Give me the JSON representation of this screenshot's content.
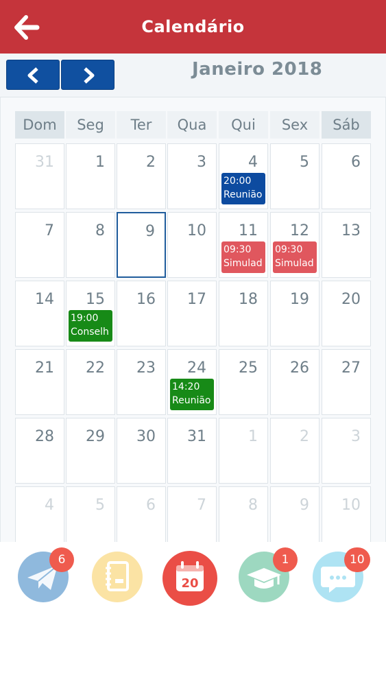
{
  "header": {
    "title": "Calendário",
    "back_icon": "arrow-left-icon"
  },
  "navigation": {
    "month_label": "Janeiro 2018",
    "prev_icon": "chevron-left-icon",
    "next_icon": "chevron-right-icon"
  },
  "weekdays": [
    "Dom",
    "Seg",
    "Ter",
    "Qua",
    "Qui",
    "Sex",
    "Sáb"
  ],
  "weeks": [
    [
      {
        "day": "31",
        "current": false
      },
      {
        "day": "1",
        "current": true
      },
      {
        "day": "2",
        "current": true
      },
      {
        "day": "3",
        "current": true
      },
      {
        "day": "4",
        "current": true,
        "events": [
          {
            "time": "20:00",
            "title": "Reunião",
            "color": "#0d4ba0"
          }
        ]
      },
      {
        "day": "5",
        "current": true
      },
      {
        "day": "6",
        "current": true
      }
    ],
    [
      {
        "day": "7",
        "current": true
      },
      {
        "day": "8",
        "current": true
      },
      {
        "day": "9",
        "current": true,
        "selected": true
      },
      {
        "day": "10",
        "current": true
      },
      {
        "day": "11",
        "current": true,
        "events": [
          {
            "time": "09:30",
            "title": "Simulad",
            "color": "#e0575e"
          }
        ]
      },
      {
        "day": "12",
        "current": true,
        "events": [
          {
            "time": "09:30",
            "title": "Simulad",
            "color": "#e0575e"
          }
        ]
      },
      {
        "day": "13",
        "current": true
      }
    ],
    [
      {
        "day": "14",
        "current": true
      },
      {
        "day": "15",
        "current": true,
        "events": [
          {
            "time": "19:00",
            "title": "Conselh",
            "color": "#178a17"
          }
        ]
      },
      {
        "day": "16",
        "current": true
      },
      {
        "day": "17",
        "current": true
      },
      {
        "day": "18",
        "current": true
      },
      {
        "day": "19",
        "current": true
      },
      {
        "day": "20",
        "current": true
      }
    ],
    [
      {
        "day": "21",
        "current": true
      },
      {
        "day": "22",
        "current": true
      },
      {
        "day": "23",
        "current": true
      },
      {
        "day": "24",
        "current": true,
        "events": [
          {
            "time": "14:20",
            "title": "Reunião",
            "color": "#178a17"
          }
        ]
      },
      {
        "day": "25",
        "current": true
      },
      {
        "day": "26",
        "current": true
      },
      {
        "day": "27",
        "current": true
      }
    ],
    [
      {
        "day": "28",
        "current": true
      },
      {
        "day": "29",
        "current": true
      },
      {
        "day": "30",
        "current": true
      },
      {
        "day": "31",
        "current": true
      },
      {
        "day": "1",
        "current": false
      },
      {
        "day": "2",
        "current": false
      },
      {
        "day": "3",
        "current": false
      }
    ],
    [
      {
        "day": "4",
        "current": false
      },
      {
        "day": "5",
        "current": false
      },
      {
        "day": "6",
        "current": false
      },
      {
        "day": "7",
        "current": false
      },
      {
        "day": "8",
        "current": false
      },
      {
        "day": "9",
        "current": false
      },
      {
        "day": "10",
        "current": false
      }
    ]
  ],
  "bottom_nav": {
    "messages": {
      "icon": "paper-plane-icon",
      "badge": "6",
      "color": "#8fb9dd"
    },
    "agenda": {
      "icon": "notebook-icon",
      "color": "#fbe3a4"
    },
    "calendar": {
      "icon": "calendar-icon",
      "label": "20",
      "color": "#ea4e46"
    },
    "academic": {
      "icon": "graduation-cap-icon",
      "badge": "1",
      "color": "#9dd8c0"
    },
    "chat": {
      "icon": "chat-bubble-icon",
      "badge": "10",
      "color": "#aee3f3"
    }
  }
}
